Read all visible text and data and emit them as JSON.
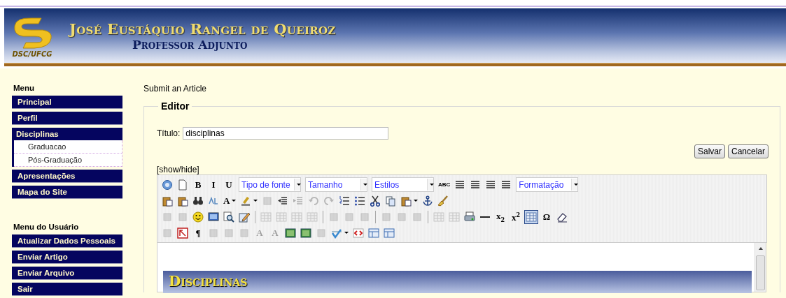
{
  "header": {
    "logo_text": "DSC/UFCG",
    "name": "José Eustáquio Rangel de Queiroz",
    "subtitle": "Professor Adjunto"
  },
  "sidebar": {
    "sections": [
      {
        "heading": "Menu",
        "items": [
          {
            "label": "Principal"
          },
          {
            "label": "Perfil"
          },
          {
            "label": "Disciplinas",
            "expanded": true,
            "children": [
              {
                "label": "Graduacao"
              },
              {
                "label": "Pós-Graduação"
              }
            ]
          },
          {
            "label": "Apresentações"
          },
          {
            "label": "Mapa do Site"
          }
        ]
      },
      {
        "heading": "Menu do Usuário",
        "items": [
          {
            "label": "Atualizar Dados Pessoais"
          },
          {
            "label": "Enviar Artigo"
          },
          {
            "label": "Enviar Arquivo"
          },
          {
            "label": "Sair"
          }
        ]
      }
    ]
  },
  "main": {
    "page_title": "Submit an Article",
    "editor": {
      "legend": "Editor",
      "title_label": "Título:",
      "title_value": "disciplinas",
      "buttons": [
        "Salvar",
        "Cancelar"
      ],
      "toggle_link": "[show/hide]",
      "toolbar_rows": [
        [
          {
            "kind": "icon",
            "disabled": false
          },
          {
            "kind": "icon",
            "disabled": false
          },
          {
            "kind": "glyph",
            "label": "B",
            "disabled": false
          },
          {
            "kind": "glyph",
            "label": "I",
            "disabled": false
          },
          {
            "kind": "glyph",
            "label": "U",
            "disabled": false
          },
          {
            "kind": "dropdown",
            "label": "Tipo de fonte"
          },
          {
            "kind": "dropdown",
            "label": "Tamanho"
          },
          {
            "kind": "dropdown",
            "label": "Estilos"
          },
          {
            "kind": "glyph",
            "label": "ABC",
            "disabled": false
          },
          {
            "kind": "icon",
            "disabled": false
          },
          {
            "kind": "icon",
            "disabled": false
          },
          {
            "kind": "icon",
            "disabled": false
          },
          {
            "kind": "icon",
            "disabled": false
          },
          {
            "kind": "dropdown",
            "label": "Formatação"
          }
        ],
        [
          {
            "kind": "icon",
            "disabled": false
          },
          {
            "kind": "icon",
            "disabled": false
          },
          {
            "kind": "icon",
            "disabled": false
          },
          {
            "kind": "icon",
            "disabled": false
          },
          {
            "kind": "glyph",
            "label": "A",
            "disabled": false,
            "menu": true
          },
          {
            "kind": "icon",
            "disabled": false,
            "menu": true
          },
          {
            "kind": "icon",
            "disabled": true
          },
          {
            "kind": "icon",
            "disabled": false
          },
          {
            "kind": "icon",
            "disabled": true
          },
          {
            "kind": "icon",
            "disabled": true
          },
          {
            "kind": "icon",
            "disabled": true
          },
          {
            "kind": "icon",
            "disabled": false
          },
          {
            "kind": "icon",
            "disabled": false
          },
          {
            "kind": "icon",
            "disabled": false
          },
          {
            "kind": "icon",
            "disabled": false
          },
          {
            "kind": "icon",
            "disabled": false,
            "menu": true
          },
          {
            "kind": "icon",
            "disabled": false
          },
          {
            "kind": "icon",
            "disabled": false
          }
        ],
        [
          {
            "kind": "icon",
            "disabled": true
          },
          {
            "kind": "icon",
            "disabled": true
          },
          {
            "kind": "icon",
            "disabled": false
          },
          {
            "kind": "icon",
            "disabled": false
          },
          {
            "kind": "icon",
            "disabled": false
          },
          {
            "kind": "icon",
            "disabled": false
          },
          {
            "kind": "separator"
          },
          {
            "kind": "icon",
            "disabled": true
          },
          {
            "kind": "icon",
            "disabled": true
          },
          {
            "kind": "icon",
            "disabled": true
          },
          {
            "kind": "icon",
            "disabled": true
          },
          {
            "kind": "separator"
          },
          {
            "kind": "icon",
            "disabled": true
          },
          {
            "kind": "icon",
            "disabled": true
          },
          {
            "kind": "icon",
            "disabled": true
          },
          {
            "kind": "separator"
          },
          {
            "kind": "icon",
            "disabled": true
          },
          {
            "kind": "icon",
            "disabled": true
          },
          {
            "kind": "icon",
            "disabled": true
          },
          {
            "kind": "separator"
          },
          {
            "kind": "icon",
            "disabled": true
          },
          {
            "kind": "icon",
            "disabled": true
          },
          {
            "kind": "icon",
            "disabled": false
          },
          {
            "kind": "icon",
            "disabled": false
          },
          {
            "kind": "glyph",
            "label": "x$_{2}$",
            "disabled": false
          },
          {
            "kind": "glyph",
            "label": "x$^{2}$",
            "disabled": false
          },
          {
            "kind": "icon",
            "disabled": false,
            "active": true
          },
          {
            "kind": "glyph",
            "label": "Ω",
            "disabled": false
          },
          {
            "kind": "icon",
            "disabled": false
          }
        ],
        [
          {
            "kind": "icon",
            "disabled": true
          },
          {
            "kind": "icon",
            "disabled": false
          },
          {
            "kind": "glyph",
            "label": "¶",
            "disabled": false
          },
          {
            "kind": "icon",
            "disabled": true
          },
          {
            "kind": "icon",
            "disabled": true
          },
          {
            "kind": "icon",
            "disabled": true
          },
          {
            "kind": "glyph",
            "label": "A",
            "disabled": true
          },
          {
            "kind": "glyph",
            "label": "A",
            "disabled": true
          },
          {
            "kind": "icon",
            "disabled": false
          },
          {
            "kind": "icon",
            "disabled": false
          },
          {
            "kind": "icon",
            "disabled": true
          },
          {
            "kind": "icon",
            "disabled": false,
            "menu": true
          },
          {
            "kind": "icon",
            "disabled": false
          },
          {
            "kind": "icon",
            "disabled": false
          },
          {
            "kind": "icon",
            "disabled": false
          }
        ]
      ],
      "content": {
        "heading": "Disciplinas"
      }
    }
  }
}
